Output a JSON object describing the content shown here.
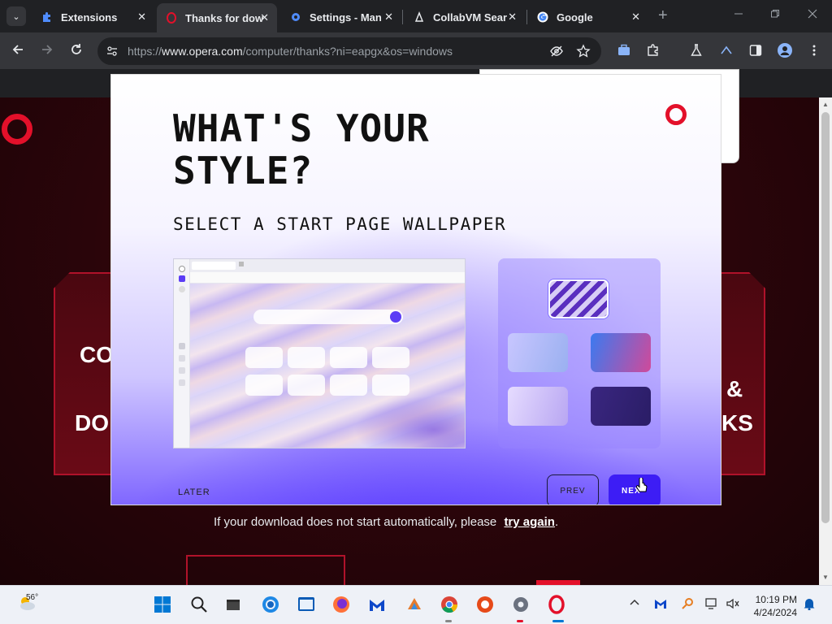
{
  "browser": {
    "tabs": [
      {
        "label": "Extensions",
        "icon": "puzzle-icon",
        "active": false
      },
      {
        "label": "Thanks for dow",
        "icon": "opera-icon",
        "active": true
      },
      {
        "label": "Settings - Man",
        "icon": "gear-icon",
        "active": false
      },
      {
        "label": "CollabVM Sear",
        "icon": "collabvm-icon",
        "active": false
      },
      {
        "label": "Google",
        "icon": "google-icon",
        "active": false
      }
    ],
    "tab_close_glyph": "✕",
    "new_tab_glyph": "+",
    "url_scheme": "https://",
    "url_host": "www.opera.com",
    "url_path": "/computer/thanks?ni=eapgx&os=windows"
  },
  "page": {
    "red_texts": [
      "CO",
      "DO",
      "&",
      "KS"
    ],
    "download_note": "If your download does not start automatically, please",
    "try_again": "try again",
    "try_again_suffix": "."
  },
  "modal": {
    "title": "WHAT'S YOUR STYLE?",
    "subtitle": "SELECT A START PAGE WALLPAPER",
    "later_label": "LATER",
    "prev_label": "PREV",
    "next_label": "NEX",
    "swatches": [
      {
        "name": "marble-purple",
        "colors": [
          "#d8cdf6",
          "#5a2fbf"
        ],
        "selected": true
      },
      {
        "name": "soft-blue",
        "colors": [
          "#c8c6ff",
          "#9ab0f0"
        ],
        "selected": false
      },
      {
        "name": "blue-pink",
        "colors": [
          "#3b7af0",
          "#d04a9a"
        ],
        "selected": false
      },
      {
        "name": "lavender",
        "colors": [
          "#e6dcff",
          "#b8a6f2"
        ],
        "selected": false
      },
      {
        "name": "deep-indigo",
        "colors": [
          "#3a2680",
          "#2a1d66"
        ],
        "selected": false
      }
    ],
    "accent": "#3d1df5",
    "brand_red": "#e3102a"
  },
  "taskbar": {
    "temperature": "56°",
    "time": "10:19 PM",
    "date": "4/24/2024",
    "apps": [
      "windows-start-icon",
      "search-icon",
      "file-explorer-icon",
      "edge-icon",
      "app-store-icon",
      "firefox-icon",
      "malwarebytes-icon",
      "collab-icon",
      "chrome-icon",
      "browser-red-icon",
      "settings-icon",
      "opera-icon"
    ]
  }
}
